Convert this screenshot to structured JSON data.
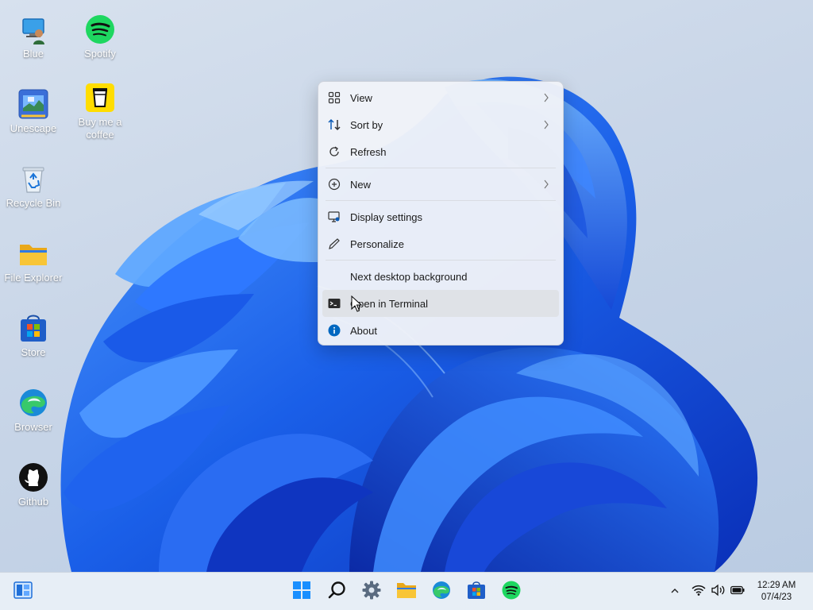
{
  "desktop": {
    "icons": [
      {
        "label": "Blue",
        "icon": "user-computer-icon"
      },
      {
        "label": "Spotify",
        "icon": "spotify-icon"
      },
      {
        "label": "Unescape",
        "icon": "unescape-app-icon"
      },
      {
        "label": "Buy me a coffee",
        "icon": "coffee-cup-icon"
      },
      {
        "label": "Recycle Bin",
        "icon": "recycle-bin-icon"
      },
      {
        "label": "File Explorer",
        "icon": "folder-icon"
      },
      {
        "label": "Store",
        "icon": "store-icon"
      },
      {
        "label": "Browser",
        "icon": "edge-browser-icon"
      },
      {
        "label": "Github",
        "icon": "github-icon"
      }
    ]
  },
  "context_menu": {
    "items": [
      {
        "label": "View",
        "icon": "grid-view-icon",
        "submenu": true
      },
      {
        "label": "Sort by",
        "icon": "sort-arrows-icon",
        "submenu": true
      },
      {
        "label": "Refresh",
        "icon": "refresh-icon",
        "submenu": false
      },
      {
        "label": "New",
        "icon": "plus-circle-icon",
        "submenu": true
      },
      {
        "label": "Display settings",
        "icon": "display-settings-icon",
        "submenu": false
      },
      {
        "label": "Personalize",
        "icon": "pen-icon",
        "submenu": false
      },
      {
        "label": "Next desktop background",
        "icon": "",
        "submenu": false
      },
      {
        "label": "Open in Terminal",
        "icon": "terminal-icon",
        "submenu": false,
        "highlighted": true
      },
      {
        "label": "About",
        "icon": "info-icon",
        "submenu": false
      }
    ]
  },
  "taskbar": {
    "apps": [
      "windows-start-icon",
      "search-icon",
      "settings-gear-icon",
      "file-explorer-icon",
      "edge-browser-icon",
      "store-icon",
      "spotify-icon"
    ],
    "tray": [
      "chevron-up-icon",
      "wifi-icon",
      "volume-icon",
      "battery-icon"
    ],
    "clock": {
      "time": "12:29 AM",
      "date": "07/4/23"
    }
  },
  "colors": {
    "accent": "#0067c0",
    "spotify_green": "#1ed760",
    "folder_yellow": "#f8c537",
    "info_blue": "#0067c0"
  }
}
